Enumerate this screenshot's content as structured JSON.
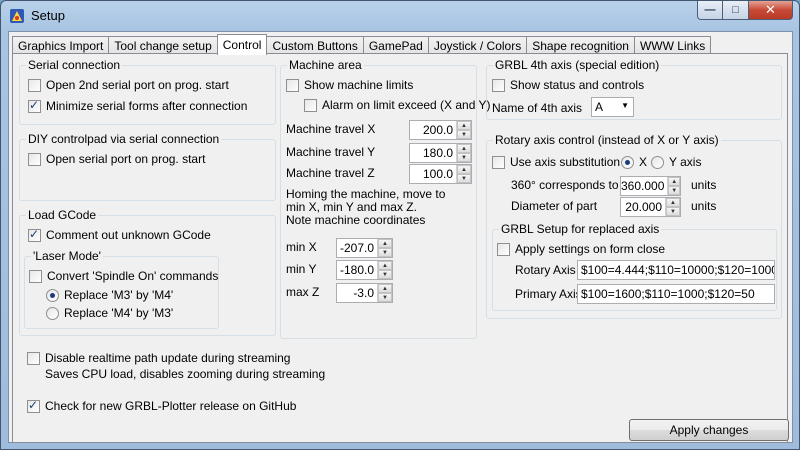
{
  "window": {
    "title": "Setup"
  },
  "tabs": [
    {
      "label": "Graphics Import"
    },
    {
      "label": "Tool change setup"
    },
    {
      "label": "Control",
      "active": true
    },
    {
      "label": "Custom Buttons"
    },
    {
      "label": "GamePad"
    },
    {
      "label": "Joystick / Colors"
    },
    {
      "label": "Shape recognition"
    },
    {
      "label": "WWW Links"
    }
  ],
  "serial": {
    "title": "Serial connection",
    "open_2nd": {
      "label": "Open 2nd serial port on prog. start",
      "checked": false
    },
    "minimize": {
      "label": "Minimize serial forms after connection",
      "checked": true
    }
  },
  "diy": {
    "title": "DIY controlpad via serial connection",
    "open_port": {
      "label": "Open serial port on prog. start",
      "checked": false
    }
  },
  "gcode": {
    "title": "Load GCode",
    "comment_unknown": {
      "label": "Comment out unknown GCode",
      "checked": true
    },
    "laser": {
      "title": "'Laser Mode'",
      "convert": {
        "label": "Convert 'Spindle On' commands",
        "checked": false
      },
      "replace_m3": {
        "label": "Replace 'M3' by 'M4'",
        "selected": true
      },
      "replace_m4": {
        "label": "Replace 'M4' by 'M3'",
        "selected": false
      }
    }
  },
  "machine": {
    "title": "Machine area",
    "show_limits": {
      "label": "Show machine limits",
      "checked": false
    },
    "alarm": {
      "label": "Alarm on limit exceed (X and Y)",
      "checked": false
    },
    "travel_x": {
      "label": "Machine travel X",
      "value": "200.0"
    },
    "travel_y": {
      "label": "Machine travel Y",
      "value": "180.0"
    },
    "travel_z": {
      "label": "Machine travel Z",
      "value": "100.0"
    },
    "homing_note": "Homing the machine, move to\nmin X, min Y and max Z.\nNote machine coordinates",
    "min_x": {
      "label": "min X",
      "value": "-207.0"
    },
    "min_y": {
      "label": "min Y",
      "value": "-180.0"
    },
    "max_z": {
      "label": "max Z",
      "value": "-3.0"
    }
  },
  "grbl4": {
    "title": "GRBL 4th axis (special edition)",
    "show_status": {
      "label": "Show status and controls",
      "checked": false
    },
    "name_label": "Name of 4th axis",
    "name_value": "A"
  },
  "rotary": {
    "title": "Rotary axis control (instead of X or Y axis)",
    "use_subst": {
      "label": "Use axis substitution",
      "checked": false
    },
    "axis_x": {
      "label": "X",
      "selected": true
    },
    "axis_y": {
      "label": "Y axis",
      "selected": false
    },
    "deg_label": "360° corresponds to",
    "deg_value": "360.000",
    "deg_unit": "units",
    "diam_label": "Diameter of part",
    "diam_value": "20.000",
    "diam_unit": "units",
    "replaced": {
      "title": "GRBL Setup for replaced axis",
      "apply": {
        "label": "Apply settings on form close",
        "checked": false
      },
      "rotary_label": "Rotary Axis",
      "rotary_value": "$100=4.444;$110=10000;$120=1000",
      "primary_label": "Primary Axis",
      "primary_value": "$100=1600;$110=1000;$120=50"
    }
  },
  "streaming": {
    "disable": {
      "label": "Disable realtime path update during streaming",
      "checked": false
    },
    "note": "Saves CPU load, disables zooming during streaming"
  },
  "check_update": {
    "label": "Check for new GRBL-Plotter release on GitHub",
    "checked": true
  },
  "apply_button": "Apply changes",
  "icons": {
    "app": "app-icon",
    "minimize": "minimize-icon",
    "maximize": "maximize-icon",
    "close": "close-icon"
  }
}
